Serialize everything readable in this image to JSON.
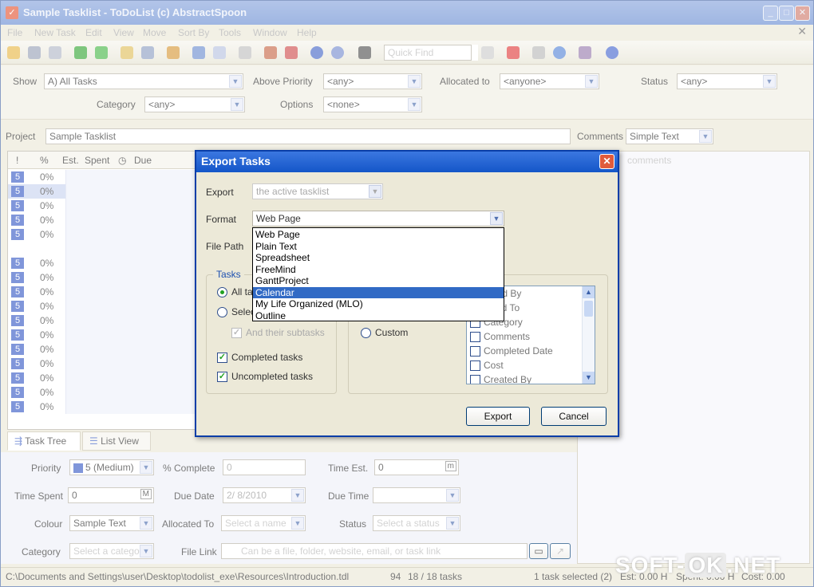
{
  "window": {
    "title": "Sample Tasklist - ToDoList (c) AbstractSpoon"
  },
  "menu": [
    "File",
    "New Task",
    "Edit",
    "View",
    "Move",
    "Sort By",
    "Tools",
    "Window",
    "Help"
  ],
  "toolbar": {
    "quickfind_placeholder": "Quick Find"
  },
  "filters": {
    "show_label": "Show",
    "show_value": "A)  All Tasks",
    "above_priority_label": "Above Priority",
    "above_priority_value": "<any>",
    "allocated_to_label": "Allocated to",
    "allocated_to_value": "<anyone>",
    "status_label": "Status",
    "status_value": "<any>",
    "category_label": "Category",
    "category_value": "<any>",
    "options_label": "Options",
    "options_value": "<none>"
  },
  "project": {
    "label": "Project",
    "value": "Sample Tasklist",
    "comments_label": "Comments",
    "comments_type": "Simple Text",
    "comments_placeholder": "comments"
  },
  "grid": {
    "headers": [
      "!",
      "%",
      "Est.",
      "Spent",
      "Due"
    ],
    "rows": [
      {
        "pri": "5",
        "pct": "0%"
      },
      {
        "pri": "5",
        "pct": "0%"
      },
      {
        "pri": "5",
        "pct": "0%"
      },
      {
        "pri": "5",
        "pct": "0%"
      },
      {
        "pri": "5",
        "pct": "0%"
      },
      {
        "pri": "",
        "pct": ""
      },
      {
        "pri": "5",
        "pct": "0%"
      },
      {
        "pri": "5",
        "pct": "0%"
      },
      {
        "pri": "5",
        "pct": "0%"
      },
      {
        "pri": "5",
        "pct": "0%"
      },
      {
        "pri": "5",
        "pct": "0%"
      },
      {
        "pri": "5",
        "pct": "0%"
      },
      {
        "pri": "5",
        "pct": "0%"
      },
      {
        "pri": "5",
        "pct": "0%"
      },
      {
        "pri": "5",
        "pct": "0%"
      },
      {
        "pri": "5",
        "pct": "0%"
      },
      {
        "pri": "5",
        "pct": "0%"
      }
    ]
  },
  "tabs": {
    "task_tree": "Task Tree",
    "list_view": "List View"
  },
  "details": {
    "priority_label": "Priority",
    "priority_value": "5 (Medium)",
    "complete_label": "% Complete",
    "complete_value": "0",
    "time_est_label": "Time Est.",
    "time_est_value": "0",
    "time_est_unit": "m",
    "time_spent_label": "Time Spent",
    "time_spent_value": "0",
    "time_spent_unit": "M",
    "due_date_label": "Due Date",
    "due_date_value": "2/ 8/2010",
    "due_time_label": "Due Time",
    "colour_label": "Colour",
    "colour_value": "Sample Text",
    "allocated_to_label": "Allocated To",
    "allocated_to_placeholder": "Select a name",
    "status_label": "Status",
    "status_placeholder": "Select a status",
    "category_label": "Category",
    "category_placeholder": "Select a catego",
    "file_link_label": "File Link",
    "file_link_placeholder": "Can be a file, folder, website, email, or task link"
  },
  "statusbar": {
    "path": "C:\\Documents and Settings\\user\\Desktop\\todolist_exe\\Resources\\Introduction.tdl",
    "count_a": "94",
    "count_b": "18 / 18 tasks",
    "selected": "1 task selected (2)",
    "est": "Est: 0.00 H",
    "spent": "Spent: 0.00 H",
    "cost": "Cost: 0.00"
  },
  "watermark": {
    "left": "SOFT-",
    "mid": "OK",
    "right": ".NET"
  },
  "dialog": {
    "title": "Export Tasks",
    "export_label": "Export",
    "export_value": "the active tasklist",
    "format_label": "Format",
    "format_value": "Web Page",
    "filepath_label": "File Path",
    "format_options": [
      "Web Page",
      "Plain Text",
      "Spreadsheet",
      "FreeMind",
      "GanttProject",
      "Calendar",
      "My Life Organized (MLO)",
      "Outline"
    ],
    "format_selected_index": 5,
    "tasks_group": "Tasks",
    "all_tasks": "All ta",
    "selected_tasks": "Selec",
    "subtasks": "And their subtasks",
    "completed": "Completed tasks",
    "uncompleted": "Uncompleted tasks",
    "custom": "Custom",
    "columns": [
      "Created By",
      "Allocated To",
      "Category",
      "Comments",
      "Completed Date",
      "Cost",
      "Created By"
    ],
    "columns_visible_text": [
      "eated By",
      "cated To",
      "Category",
      "Comments",
      "Completed Date",
      "Cost",
      "Created By"
    ],
    "export_button": "Export",
    "cancel_button": "Cancel"
  }
}
